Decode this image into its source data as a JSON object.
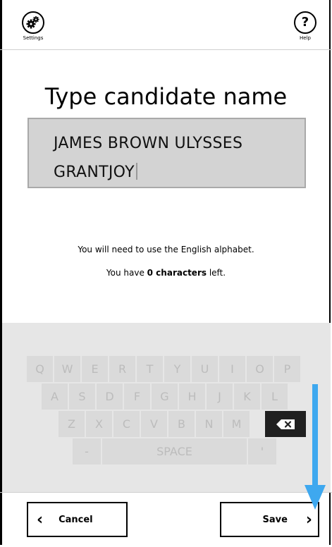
{
  "header": {
    "settings_label": "Settings",
    "help_label": "Help",
    "help_glyph": "?",
    "settings_icon": "gear-icon",
    "help_icon": "question-icon"
  },
  "title": "Type candidate name",
  "name_input": {
    "line1": "JAMES  BROWN ULYSSES",
    "line2": "GRANTJOY"
  },
  "hints": {
    "alphabet": "You will need to use the English alphabet.",
    "remaining_prefix": "You have ",
    "remaining_count": "0 characters",
    "remaining_suffix": " left."
  },
  "keyboard": {
    "row1": [
      "Q",
      "W",
      "E",
      "R",
      "T",
      "Y",
      "U",
      "I",
      "O",
      "P"
    ],
    "row2": [
      "A",
      "S",
      "D",
      "F",
      "G",
      "H",
      "J",
      "K",
      "L"
    ],
    "row3": [
      "Z",
      "X",
      "C",
      "V",
      "B",
      "N",
      "M"
    ],
    "backspace_icon": "backspace-icon",
    "dash": "-",
    "space": "SPACE",
    "apostrophe": "'"
  },
  "footer": {
    "cancel_label": "Cancel",
    "save_label": "Save"
  },
  "colors": {
    "arrow": "#3ea8ef",
    "key_bg": "#dadada",
    "key_text": "#bcbcbc",
    "name_box": "#d3d3d3"
  }
}
